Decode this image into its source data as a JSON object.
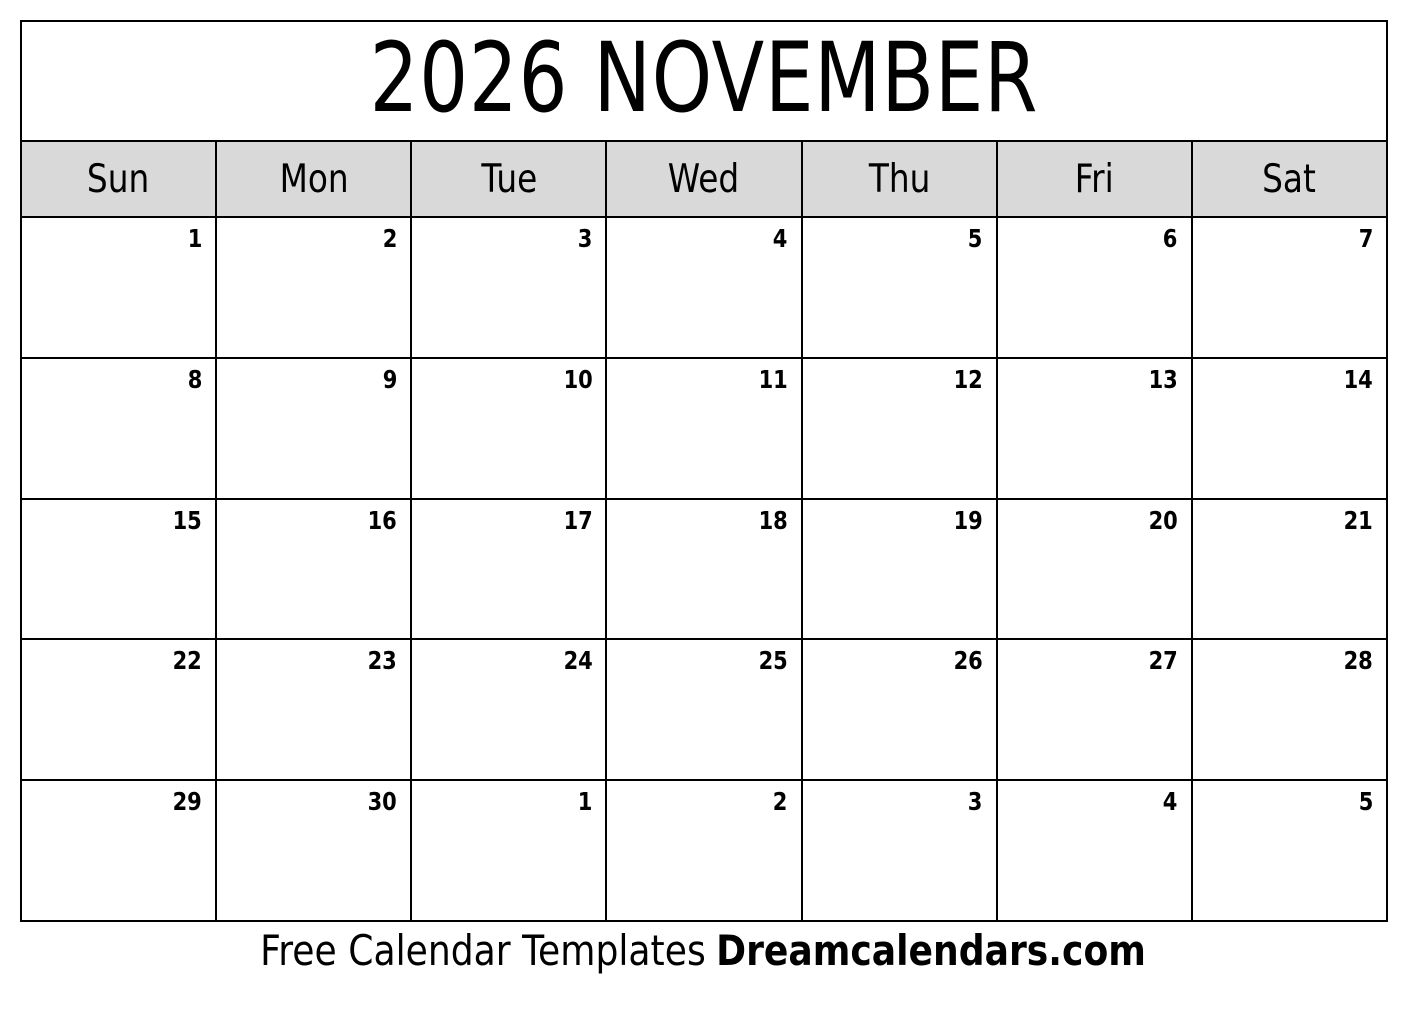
{
  "calendar": {
    "title": "2026 NOVEMBER",
    "year": "2026",
    "month_name": "NOVEMBER",
    "week_start": "Sun",
    "header_background": "#d9d9d9",
    "border_color": "#000000",
    "page_background": "#ffffff",
    "weekdays": [
      {
        "label": "Sun"
      },
      {
        "label": "Mon"
      },
      {
        "label": "Tue"
      },
      {
        "label": "Wed"
      },
      {
        "label": "Thu"
      },
      {
        "label": "Fri"
      },
      {
        "label": "Sat"
      }
    ],
    "weeks": [
      {
        "days": [
          {
            "number": "1"
          },
          {
            "number": "2"
          },
          {
            "number": "3"
          },
          {
            "number": "4"
          },
          {
            "number": "5"
          },
          {
            "number": "6"
          },
          {
            "number": "7"
          }
        ]
      },
      {
        "days": [
          {
            "number": "8"
          },
          {
            "number": "9"
          },
          {
            "number": "10"
          },
          {
            "number": "11"
          },
          {
            "number": "12"
          },
          {
            "number": "13"
          },
          {
            "number": "14"
          }
        ]
      },
      {
        "days": [
          {
            "number": "15"
          },
          {
            "number": "16"
          },
          {
            "number": "17"
          },
          {
            "number": "18"
          },
          {
            "number": "19"
          },
          {
            "number": "20"
          },
          {
            "number": "21"
          }
        ]
      },
      {
        "days": [
          {
            "number": "22"
          },
          {
            "number": "23"
          },
          {
            "number": "24"
          },
          {
            "number": "25"
          },
          {
            "number": "26"
          },
          {
            "number": "27"
          },
          {
            "number": "28"
          }
        ]
      },
      {
        "days": [
          {
            "number": "29"
          },
          {
            "number": "30"
          },
          {
            "number": "1"
          },
          {
            "number": "2"
          },
          {
            "number": "3"
          },
          {
            "number": "4"
          },
          {
            "number": "5"
          }
        ]
      }
    ]
  },
  "footer": {
    "free_text": "Free Calendar Templates",
    "brand_text": "Dreamcalendars.com"
  }
}
